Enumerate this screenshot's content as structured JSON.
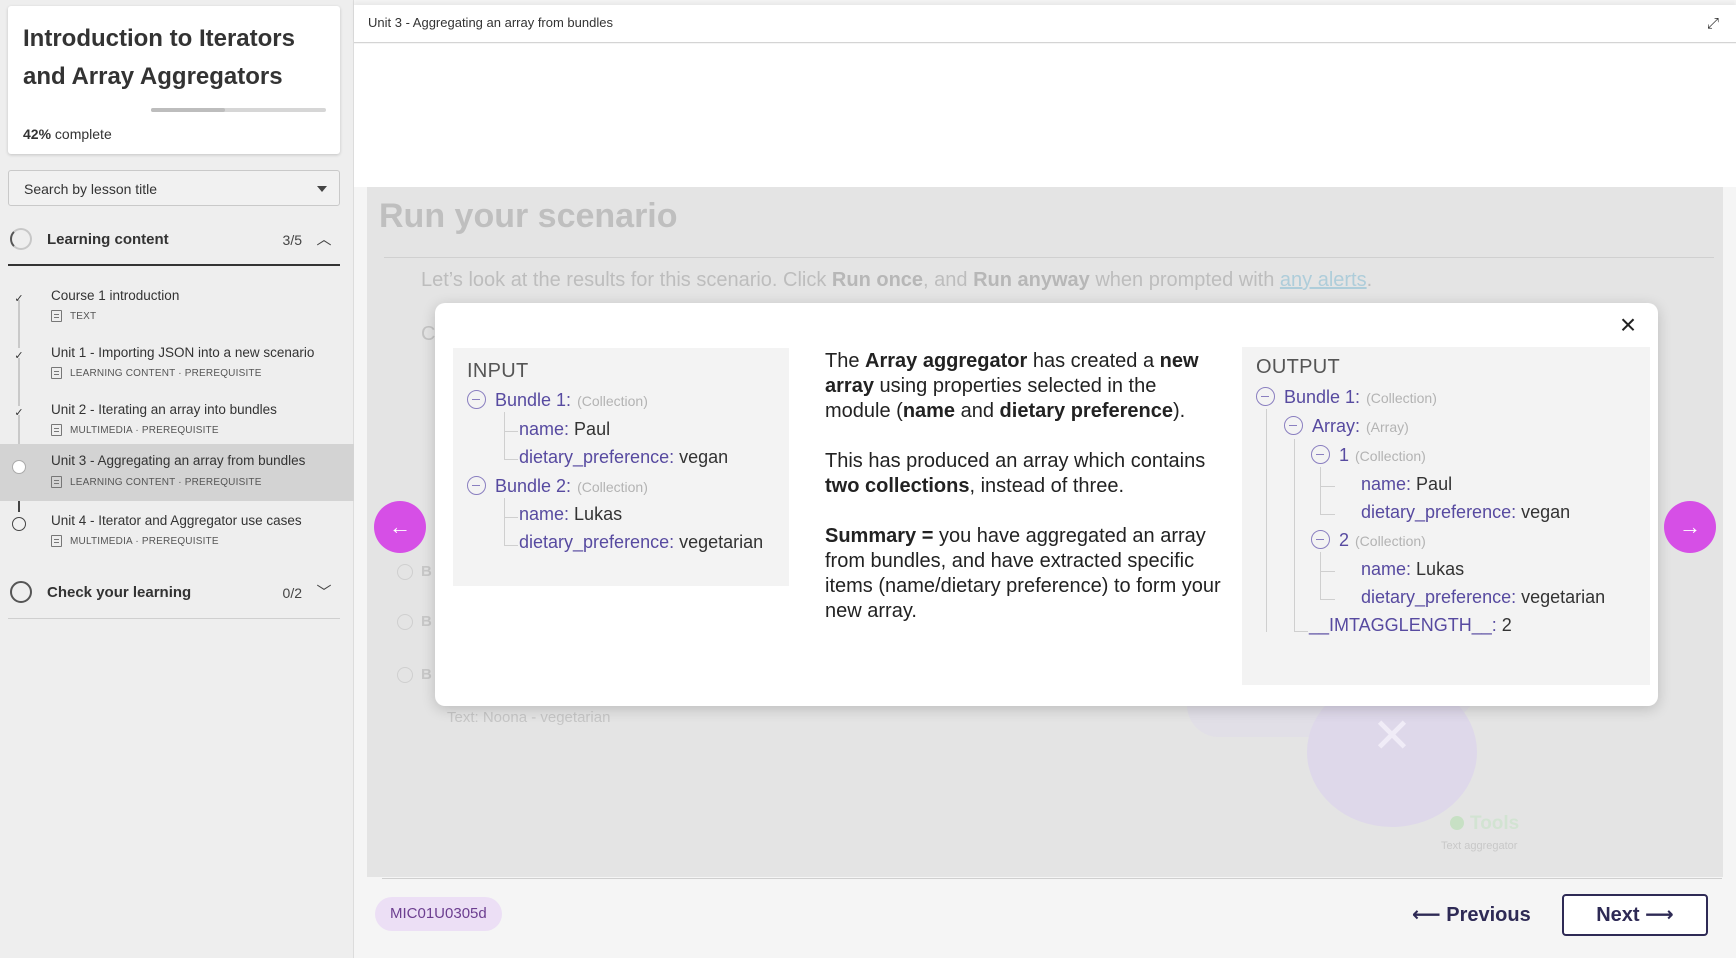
{
  "sidebar": {
    "course_title": "Introduction to Iterators and Array Aggregators",
    "progress": {
      "percent_label": "42%",
      "suffix": "complete",
      "value": 0.42
    },
    "search_placeholder": "Search by lesson title",
    "sections": [
      {
        "label": "Learning content",
        "count": "3/5",
        "expanded": true
      },
      {
        "label": "Check your learning",
        "count": "0/2",
        "expanded": false
      }
    ],
    "lessons": [
      {
        "title": "Course 1 introduction",
        "meta": "TEXT",
        "status": "done"
      },
      {
        "title": "Unit 1 - Importing JSON into a new scenario",
        "meta": "LEARNING CONTENT · PREREQUISITE",
        "status": "done"
      },
      {
        "title": "Unit 2 - Iterating an array into bundles",
        "meta": "MULTIMEDIA · PREREQUISITE",
        "status": "done"
      },
      {
        "title": "Unit 3 - Aggregating an array from bundles",
        "meta": "LEARNING CONTENT · PREREQUISITE",
        "status": "current"
      },
      {
        "title": "Unit 4 - Iterator and Aggregator use cases",
        "meta": "MULTIMEDIA · PREREQUISITE",
        "status": "todo"
      }
    ]
  },
  "header": {
    "unit_title": "Unit 3 - Aggregating an array from bundles"
  },
  "background": {
    "title": "Run your scenario",
    "intro_1": "Let’s look at the results for this scenario. Click ",
    "run_once": "Run once",
    "intro_2": ", and ",
    "run_anyway": "Run anyway",
    "intro_3": " when prompted with ",
    "alerts_link": "any alerts",
    "intro_4": ".",
    "c_letter": "C",
    "b_letter": "B",
    "noona_text": "Text:  Noona - vegetarian",
    "tools_label": "Tools",
    "text_aggregator": "Text aggregator"
  },
  "modal": {
    "input": {
      "title": "INPUT",
      "bundle1_label": "Bundle 1:",
      "bundle2_label": "Bundle 2:",
      "collection_type": "(Collection)",
      "name_key": "name:",
      "diet_key": "dietary_preference:",
      "bundle1_name": "Paul",
      "bundle1_diet": "vegan",
      "bundle2_name": "Lukas",
      "bundle2_diet": "vegetarian"
    },
    "explanation": {
      "p1_a": "The ",
      "p1_b": "Array aggregator",
      "p1_c": " has created a ",
      "p1_d": "new array",
      "p1_e": " using properties selected in the module (",
      "p1_f": "name",
      "p1_g": " and ",
      "p1_h": "dietary preference",
      "p1_i": ").",
      "p2_a": "This has produced an array which contains ",
      "p2_b": "two collections",
      "p2_c": ", instead of three.",
      "p3_a": "Summary =",
      "p3_b": " you have aggregated an array from bundles, and have extracted specific items (name/dietary preference) to form your new array."
    },
    "output": {
      "title": "OUTPUT",
      "bundle1_label": "Bundle 1:",
      "collection_type": "(Collection)",
      "array_label": "Array:",
      "array_type": "(Array)",
      "item1_label": "1",
      "item2_label": "2",
      "name_key": "name:",
      "diet_key": "dietary_preference:",
      "item1_name": "Paul",
      "item1_diet": "vegan",
      "item2_name": "Lukas",
      "item2_diet": "vegetarian",
      "length_key": "__IMTAGGLENGTH__:",
      "length_val": "2"
    }
  },
  "footer": {
    "lesson_code": "MIC01U0305d",
    "previous_label": "Previous",
    "next_label": "Next"
  },
  "colors": {
    "accent": "#d64fe6",
    "tree_key": "#574aa0",
    "button_text": "#2e2a55",
    "badge_bg": "#ecdff5"
  }
}
